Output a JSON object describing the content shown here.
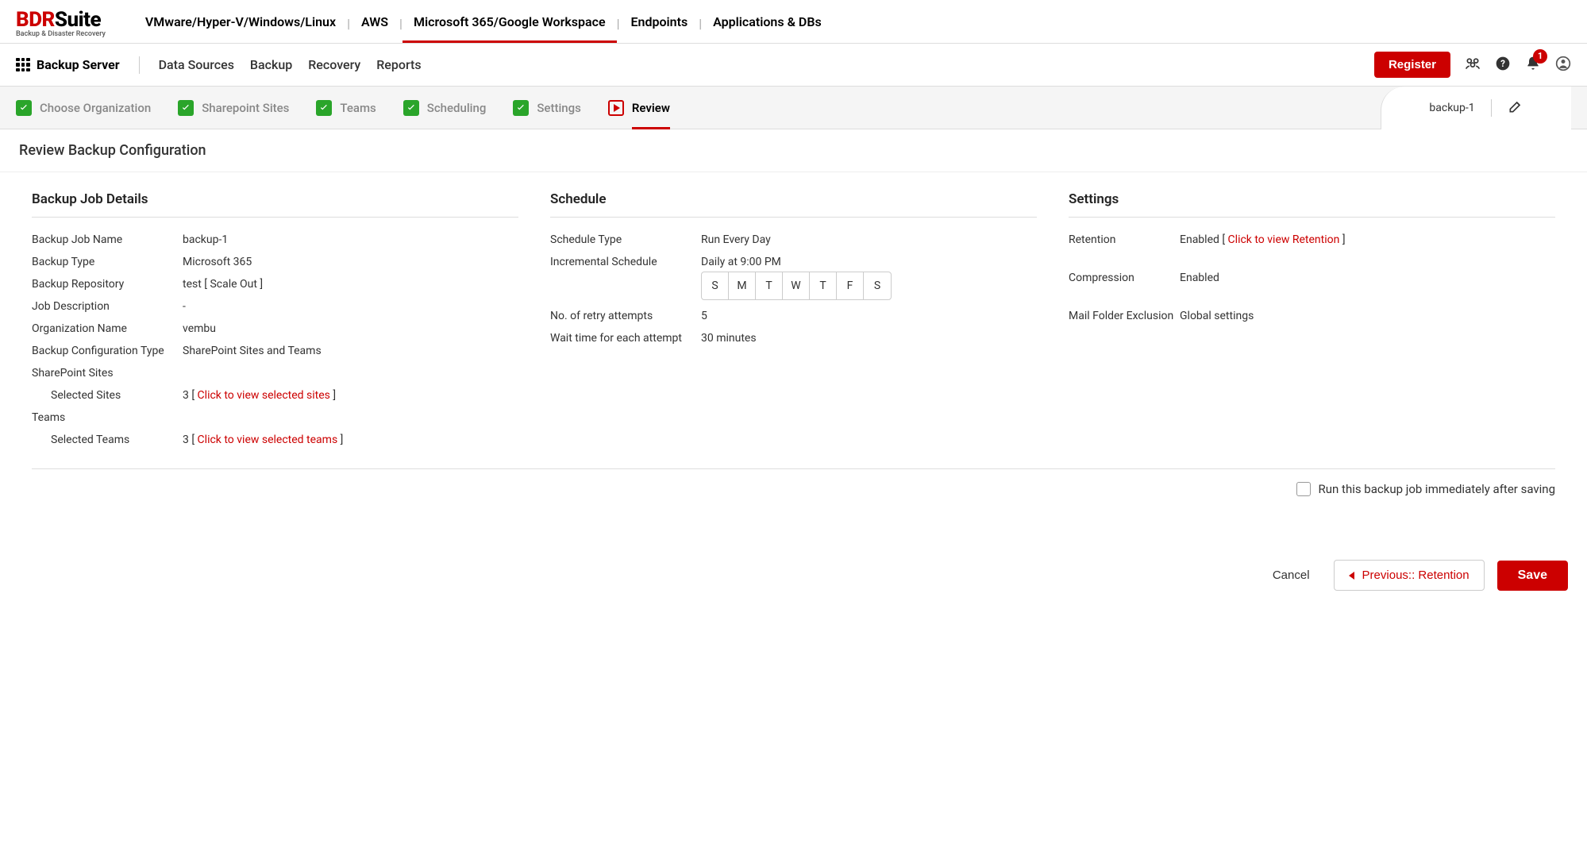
{
  "logo": {
    "part1": "BDR",
    "part2": "Suite",
    "sub": "Backup & Disaster Recovery"
  },
  "nav1": {
    "items": [
      "VMware/Hyper-V/Windows/Linux",
      "AWS",
      "Microsoft 365/Google Workspace",
      "Endpoints",
      "Applications & DBs"
    ],
    "active_index": 2
  },
  "nav2": {
    "label": "Backup Server",
    "items": [
      "Data Sources",
      "Backup",
      "Recovery",
      "Reports"
    ],
    "register": "Register",
    "badge": "1"
  },
  "wizard": {
    "steps": [
      {
        "label": "Choose Organization"
      },
      {
        "label": "Sharepoint Sites"
      },
      {
        "label": "Teams"
      },
      {
        "label": "Scheduling"
      },
      {
        "label": "Settings"
      },
      {
        "label": "Review"
      }
    ],
    "job_name": "backup-1"
  },
  "page_title": "Review Backup Configuration",
  "details": {
    "heading": "Backup Job Details",
    "rows": {
      "job_name_k": "Backup Job Name",
      "job_name_v": "backup-1",
      "type_k": "Backup Type",
      "type_v": "Microsoft 365",
      "repo_k": "Backup Repository",
      "repo_v": "test [ Scale Out ]",
      "desc_k": "Job Description",
      "desc_v": "-",
      "org_k": "Organization Name",
      "org_v": "vembu",
      "conf_k": "Backup Configuration Type",
      "conf_v": "SharePoint Sites and Teams",
      "sp_head": "SharePoint Sites",
      "sites_k": "Selected Sites",
      "sites_count": "3",
      "sites_link": "Click to view selected sites",
      "teams_head": "Teams",
      "teams_k": "Selected Teams",
      "teams_count": "3",
      "teams_link": "Click to view selected teams"
    }
  },
  "schedule": {
    "heading": "Schedule",
    "type_k": "Schedule Type",
    "type_v": "Run Every Day",
    "incr_k": "Incremental Schedule",
    "incr_v": "Daily at 9:00 PM",
    "days": [
      "S",
      "M",
      "T",
      "W",
      "T",
      "F",
      "S"
    ],
    "retry_k": "No. of retry attempts",
    "retry_v": "5",
    "wait_k": "Wait time for each attempt",
    "wait_v": "30 minutes"
  },
  "settings": {
    "heading": "Settings",
    "ret_k": "Retention",
    "ret_v_prefix": "Enabled [ ",
    "ret_link": "Click to view Retention",
    "ret_v_suffix": " ]",
    "comp_k": "Compression",
    "comp_v": "Enabled",
    "mail_k": "Mail Folder Exclusion",
    "mail_v": "Global settings"
  },
  "run_now": "Run this backup job immediately after saving",
  "footer": {
    "cancel": "Cancel",
    "prev": "Previous:: Retention",
    "save": "Save"
  }
}
